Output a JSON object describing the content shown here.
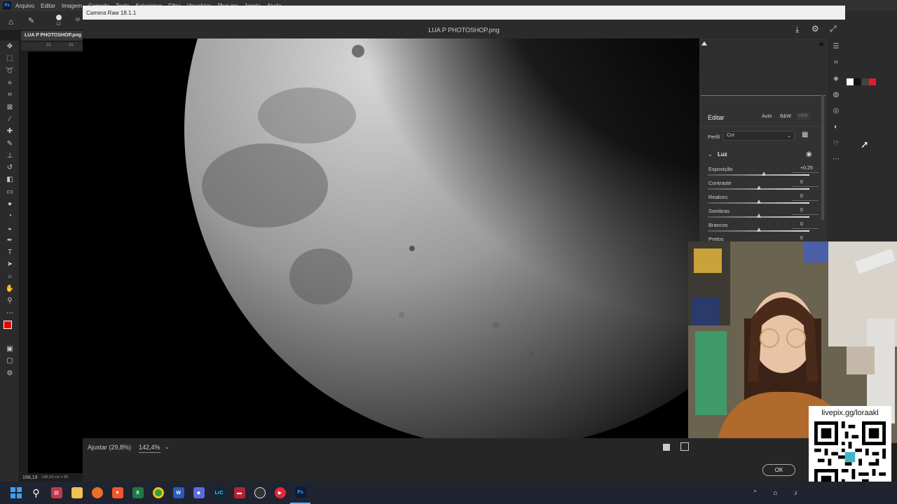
{
  "photoshop": {
    "logo": "Ps",
    "menu": [
      "Arquivo",
      "Editar",
      "Imagem",
      "Camada",
      "Texto",
      "Selecionar",
      "Filtro",
      "Visualizar",
      "Plug-ins",
      "Janela",
      "Ajuda"
    ],
    "options_brush_size": "12",
    "options_mode_short": "M",
    "document_tab": "LUA P PHOTOSHOP.png",
    "ruler_ticks": [
      "55",
      "56"
    ],
    "status_zoom": "168,19",
    "status_size": "146,19 cm x 99",
    "swatch_colors": [
      "#ffffff",
      "#111111",
      "#444444",
      "#e11d2a"
    ]
  },
  "camera_raw": {
    "window_title": "Camera Raw 18.1.1",
    "file_name": "LUA P PHOTOSHOP.png",
    "panel": {
      "edit_title": "Editar",
      "auto_label": "Auto",
      "bw_label": "B&W",
      "hdr_label": "HDR",
      "profile_label": "Perfil",
      "profile_value": "Cor",
      "section_title": "Luz",
      "sliders": [
        {
          "label": "Exposição",
          "value": "+0.25",
          "pos": 0.55
        },
        {
          "label": "Contraste",
          "value": "0",
          "pos": 0.5
        },
        {
          "label": "Realces",
          "value": "0",
          "pos": 0.5
        },
        {
          "label": "Sombras",
          "value": "0",
          "pos": 0.5
        },
        {
          "label": "Brancos",
          "value": "0",
          "pos": 0.5
        },
        {
          "label": "Pretos",
          "value": "0",
          "pos": 0.5
        }
      ]
    },
    "footer": {
      "fit_label": "Ajustar (29,8%)",
      "zoom_value": "142,4%",
      "ok_label": "OK"
    }
  },
  "overlay": {
    "livepix_label": "livepix.gg/loraakl"
  },
  "taskbar": {
    "lrc_label": "LrC",
    "ps_label": "Ps"
  }
}
